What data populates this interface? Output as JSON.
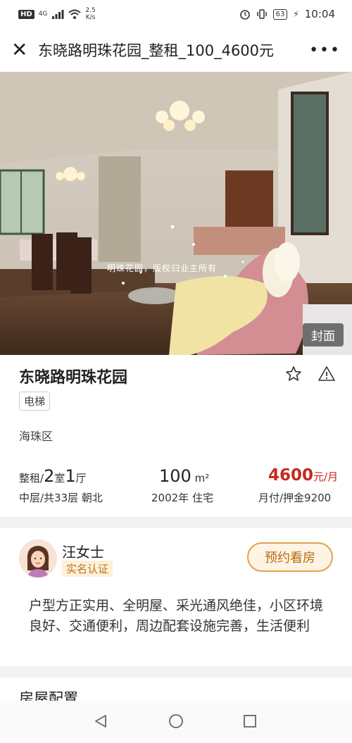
{
  "status_bar": {
    "hd": "HD",
    "network": "4G",
    "speed_value": "2.5",
    "speed_unit": "K/s",
    "battery": "63",
    "time": "10:04"
  },
  "title_bar": {
    "title": "东晓路明珠花园_整租_100_4600元"
  },
  "photo": {
    "watermark": "明珠花园，版权归业主所有",
    "cover_label": "封面"
  },
  "listing": {
    "name": "东晓路明珠花园",
    "tag": "电梯",
    "district": "海珠区",
    "layout": {
      "prefix": "整租/",
      "rooms": "2",
      "room_unit": "室",
      "halls": "1",
      "hall_unit": "厅",
      "sub": "中层/共33层 朝北"
    },
    "area": {
      "value": "100",
      "unit": " m²",
      "sub": "2002年 住宅"
    },
    "price": {
      "value": "4600",
      "unit": "元/月",
      "sub": "月付/押金9200"
    }
  },
  "agent": {
    "name": "汪女士",
    "badge": "实名认证",
    "book_button": "预约看房",
    "description": "户型方正实用、全明屋、采光通风绝佳，小区环境良好、交通便利，周边配套设施完善，生活便利"
  },
  "config": {
    "title": "房屋配置"
  },
  "colors": {
    "price_red": "#c6291f",
    "accent_orange": "#e3a24a"
  }
}
